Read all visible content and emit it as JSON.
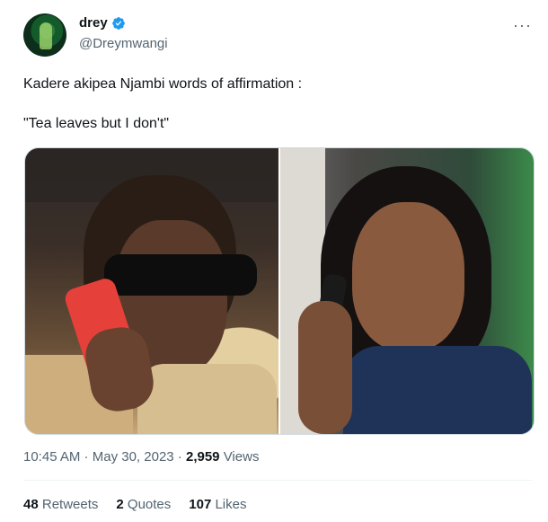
{
  "author": {
    "display_name": "drey",
    "handle": "@Dreymwangi",
    "verified_badge_color": "#1d9bf0",
    "avatar_icon": "avatar-icon"
  },
  "tweet": {
    "text": "Kadere akipea Njambi words of affirmation :\n\n\"Tea leaves but I don't\""
  },
  "meta": {
    "time": "10:45 AM",
    "separator1": " · ",
    "date": "May 30, 2023",
    "separator2": " · ",
    "views_count": "2,959",
    "views_label": " Views"
  },
  "stats": {
    "retweets_count": "48",
    "retweets_label": " Retweets",
    "quotes_count": "2",
    "quotes_label": " Quotes",
    "likes_count": "107",
    "likes_label": " Likes"
  },
  "more_icon": "more-horizontal-icon"
}
